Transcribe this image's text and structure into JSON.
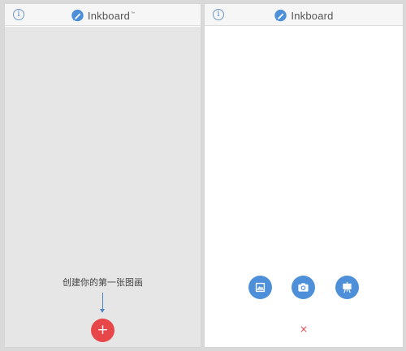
{
  "app": {
    "name": "Inkboard",
    "trademark": "™"
  },
  "icons": {
    "info": "i",
    "add": "+",
    "close": "×"
  },
  "left_screen": {
    "hint_text": "创建你的第一张图画"
  },
  "colors": {
    "accent_blue": "#4d90d9",
    "accent_red": "#e8474a"
  }
}
